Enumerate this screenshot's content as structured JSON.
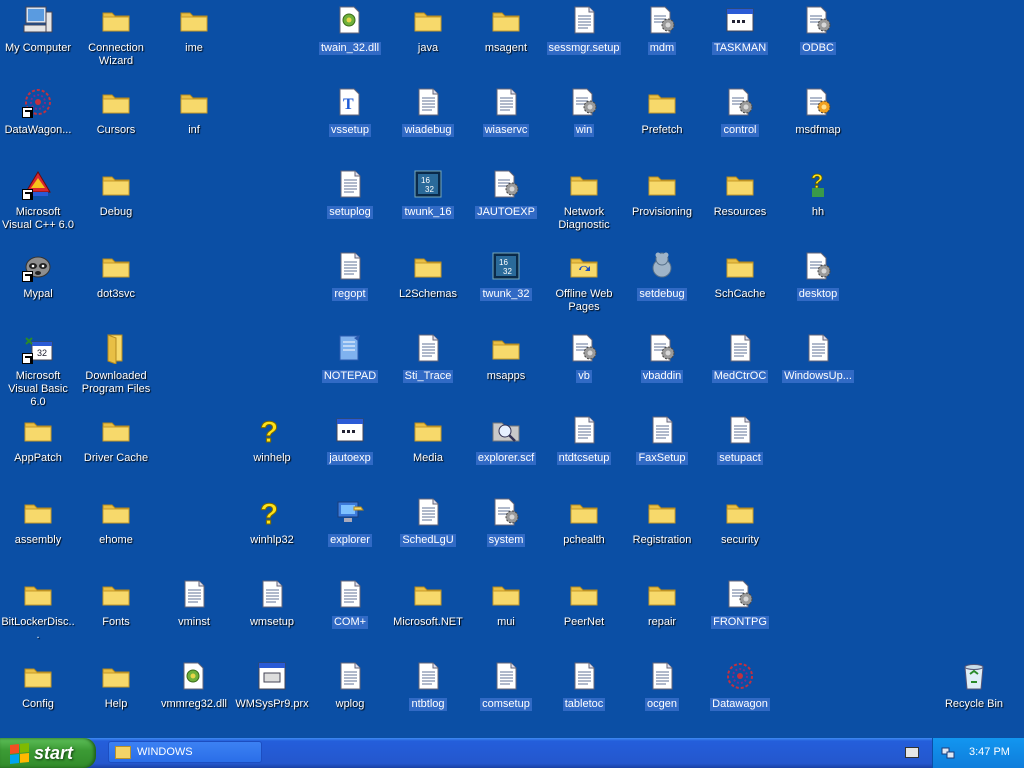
{
  "desktop": {
    "icons": [
      {
        "label": "My Computer",
        "icon": "my-computer"
      },
      {
        "label": "DataWagon...",
        "icon": "datawagon-shortcut"
      },
      {
        "label": "Microsoft Visual C++ 6.0",
        "icon": "vcpp-shortcut"
      },
      {
        "label": "Mypal",
        "icon": "mypal-shortcut"
      },
      {
        "label": "Microsoft Visual Basic 6.0",
        "icon": "vb6-shortcut"
      },
      {
        "label": "AppPatch",
        "icon": "folder"
      },
      {
        "label": "assembly",
        "icon": "folder"
      },
      {
        "label": "BitLockerDisc...",
        "icon": "folder"
      },
      {
        "label": "Config",
        "icon": "folder"
      },
      {
        "label": "Connection Wizard",
        "icon": "folder"
      },
      {
        "label": "Cursors",
        "icon": "folder"
      },
      {
        "label": "Debug",
        "icon": "folder"
      },
      {
        "label": "dot3svc",
        "icon": "folder"
      },
      {
        "label": "Downloaded Program Files",
        "icon": "folder-special"
      },
      {
        "label": "Driver Cache",
        "icon": "folder"
      },
      {
        "label": "ehome",
        "icon": "folder"
      },
      {
        "label": "Fonts",
        "icon": "folder"
      },
      {
        "label": "Help",
        "icon": "folder"
      },
      {
        "label": "ime",
        "icon": "folder"
      },
      {
        "label": "inf",
        "icon": "folder"
      },
      {
        "label": "vminst",
        "icon": "text-file"
      },
      {
        "label": "vmmreg32.dll",
        "icon": "dll"
      },
      {
        "label": "winhelp",
        "icon": "help"
      },
      {
        "label": "winhlp32",
        "icon": "help"
      },
      {
        "label": "wmsetup",
        "icon": "text-file"
      },
      {
        "label": "WMSysPr9.prx",
        "icon": "prx"
      },
      {
        "label": "twain_32.dll",
        "icon": "dll",
        "selected": true
      },
      {
        "label": "vssetup",
        "icon": "font-file",
        "selected": true
      },
      {
        "label": "setuplog",
        "icon": "text-file",
        "selected": true
      },
      {
        "label": "regopt",
        "icon": "text-file",
        "selected": true
      },
      {
        "label": "NOTEPAD",
        "icon": "notepad",
        "selected": true
      },
      {
        "label": "jautoexp",
        "icon": "window-app",
        "selected": true
      },
      {
        "label": "explorer",
        "icon": "explorer",
        "selected": true
      },
      {
        "label": "COM+",
        "icon": "text-file",
        "selected": true
      },
      {
        "label": "wplog",
        "icon": "text-file"
      },
      {
        "label": "java",
        "icon": "folder"
      },
      {
        "label": "wiadebug",
        "icon": "text-file",
        "selected": true
      },
      {
        "label": "twunk_16",
        "icon": "twunk",
        "selected": true
      },
      {
        "label": "L2Schemas",
        "icon": "folder"
      },
      {
        "label": "Sti_Trace",
        "icon": "text-file",
        "selected": true
      },
      {
        "label": "Media",
        "icon": "folder"
      },
      {
        "label": "SchedLgU",
        "icon": "text-file",
        "selected": true
      },
      {
        "label": "Microsoft.NET",
        "icon": "folder"
      },
      {
        "label": "ntbtlog",
        "icon": "text-file",
        "selected": true
      },
      {
        "label": "msagent",
        "icon": "folder"
      },
      {
        "label": "wiaservc",
        "icon": "text-file",
        "selected": true
      },
      {
        "label": "JAUTOEXP",
        "icon": "config-file",
        "selected": true
      },
      {
        "label": "twunk_32",
        "icon": "twunk",
        "selected": true
      },
      {
        "label": "msapps",
        "icon": "folder"
      },
      {
        "label": "explorer.scf",
        "icon": "explorer-scf",
        "selected": true
      },
      {
        "label": "system",
        "icon": "config-file",
        "selected": true
      },
      {
        "label": "mui",
        "icon": "folder"
      },
      {
        "label": "comsetup",
        "icon": "text-file",
        "selected": true
      },
      {
        "label": "sessmgr.setup",
        "icon": "text-file",
        "selected": true
      },
      {
        "label": "win",
        "icon": "config-file",
        "selected": true
      },
      {
        "label": "Network Diagnostic",
        "icon": "folder"
      },
      {
        "label": "Offline Web Pages",
        "icon": "offline-folder"
      },
      {
        "label": "vb",
        "icon": "config-file",
        "selected": true
      },
      {
        "label": "ntdtcsetup",
        "icon": "text-file",
        "selected": true
      },
      {
        "label": "pchealth",
        "icon": "folder"
      },
      {
        "label": "PeerNet",
        "icon": "folder"
      },
      {
        "label": "tabletoc",
        "icon": "text-file",
        "selected": true
      },
      {
        "label": "mdm",
        "icon": "config-file",
        "selected": true
      },
      {
        "label": "Prefetch",
        "icon": "folder"
      },
      {
        "label": "Provisioning",
        "icon": "folder"
      },
      {
        "label": "setdebug",
        "icon": "setdebug",
        "selected": true
      },
      {
        "label": "vbaddin",
        "icon": "config-file",
        "selected": true
      },
      {
        "label": "FaxSetup",
        "icon": "text-file",
        "selected": true
      },
      {
        "label": "Registration",
        "icon": "folder"
      },
      {
        "label": "repair",
        "icon": "folder"
      },
      {
        "label": "ocgen",
        "icon": "text-file",
        "selected": true
      },
      {
        "label": "TASKMAN",
        "icon": "window-app",
        "selected": true
      },
      {
        "label": "control",
        "icon": "config-file",
        "selected": true
      },
      {
        "label": "Resources",
        "icon": "folder"
      },
      {
        "label": "SchCache",
        "icon": "folder"
      },
      {
        "label": "MedCtrOC",
        "icon": "text-file",
        "selected": true
      },
      {
        "label": "setupact",
        "icon": "text-file",
        "selected": true
      },
      {
        "label": "security",
        "icon": "folder"
      },
      {
        "label": "FRONTPG",
        "icon": "config-file",
        "selected": true
      },
      {
        "label": "Datawagon",
        "icon": "datawagon",
        "selected": true
      },
      {
        "label": "ODBC",
        "icon": "config-file",
        "selected": true
      },
      {
        "label": "msdfmap",
        "icon": "config-file-orange"
      },
      {
        "label": "hh",
        "icon": "hh-help"
      },
      {
        "label": "desktop",
        "icon": "config-file",
        "selected": true
      },
      {
        "label": "WindowsUp...",
        "icon": "text-file",
        "selected": true
      },
      {
        "label": "Recycle Bin",
        "icon": "recycle-bin"
      }
    ]
  },
  "taskbar": {
    "start_label": "start",
    "window_button": "WINDOWS",
    "clock": "3:47 PM"
  },
  "colors": {
    "desktop": "#0b4fa5",
    "selection": "#316ac5",
    "folder": "#f4d468"
  }
}
